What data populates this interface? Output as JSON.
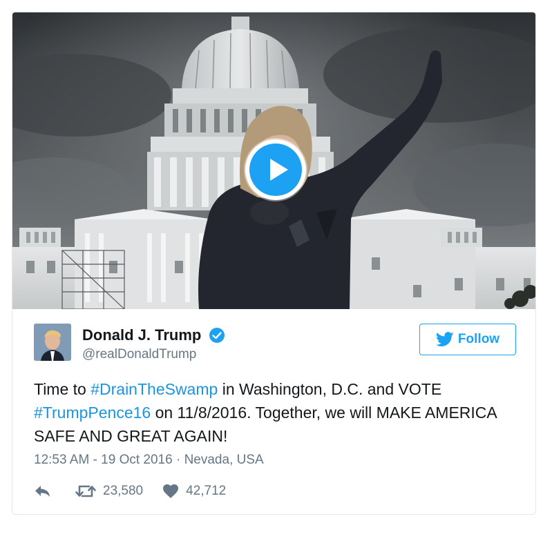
{
  "media": {
    "play_icon": "play-icon",
    "kind": "video"
  },
  "author": {
    "display_name": "Donald J. Trump",
    "screen_name": "@realDonaldTrump",
    "verified_icon": "verified-badge-icon"
  },
  "follow_button": {
    "label": "Follow",
    "icon": "twitter-bird-icon"
  },
  "tweet": {
    "segments": [
      {
        "text": "Time to ",
        "type": "text"
      },
      {
        "text": "#DrainTheSwamp",
        "type": "hashtag"
      },
      {
        "text": " in Washington, D.C. and VOTE ",
        "type": "text"
      },
      {
        "text": "#TrumpPence16",
        "type": "hashtag"
      },
      {
        "text": " on 11/8/2016. Together, we will MAKE AMERICA SAFE AND GREAT AGAIN!",
        "type": "text"
      }
    ]
  },
  "meta": {
    "timestamp": "12:53 AM - 19 Oct 2016",
    "separator": "·",
    "location": "Nevada, USA"
  },
  "actions": {
    "reply_icon": "reply-icon",
    "retweet_icon": "retweet-icon",
    "retweet_count": "23,580",
    "like_icon": "heart-icon",
    "like_count": "42,712"
  },
  "colors": {
    "accent": "#1da1f2",
    "hashtag": "#1b95e0",
    "muted": "#657786",
    "text": "#14171a",
    "border": "#e1e8ed"
  }
}
